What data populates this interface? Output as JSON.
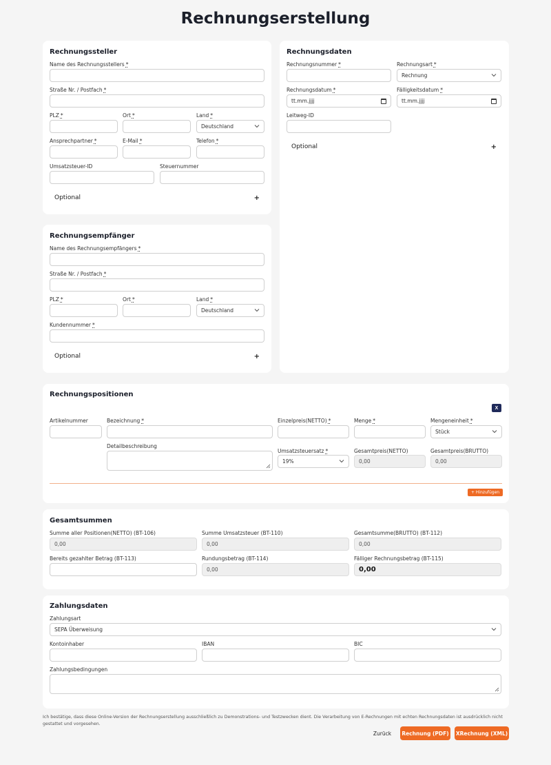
{
  "page": {
    "title": "Rechnungserstellung"
  },
  "req_mark": "*",
  "seller": {
    "title": "Rechnungssteller",
    "name_label": "Name des Rechnungsstellers",
    "street_label": "Straße Nr. / Postfach",
    "zip_label": "PLZ",
    "city_label": "Ort",
    "country_label": "Land",
    "country_value": "Deutschland",
    "contact_label": "Ansprechpartner",
    "email_label": "E-Mail",
    "phone_label": "Telefon",
    "vat_label": "Umsatzsteuer-ID",
    "tax_label": "Steuernummer",
    "optional_label": "Optional",
    "optional_icon": "+"
  },
  "invoice": {
    "title": "Rechnungsdaten",
    "number_label": "Rechnungsnummer",
    "type_label": "Rechnungsart",
    "type_value": "Rechnung",
    "date_label": "Rechnungsdatum",
    "date_value": "tt.mm.jjjj",
    "due_label": "Fälligkeitsdatum",
    "due_value": "tt.mm.jjjj",
    "leitweg_label": "Leitweg-ID",
    "optional_label": "Optional",
    "optional_icon": "+"
  },
  "recipient": {
    "title": "Rechnungsempfänger",
    "name_label": "Name des Rechnungsempfängers",
    "street_label": "Straße Nr. / Postfach",
    "zip_label": "PLZ",
    "city_label": "Ort",
    "country_label": "Land",
    "country_value": "Deutschland",
    "customer_label": "Kundennummer",
    "optional_label": "Optional",
    "optional_icon": "+"
  },
  "positions": {
    "title": "Rechnungspositionen",
    "remove_label": "X",
    "article_label": "Artikelnummer",
    "desc_label": "Bezeichnung",
    "price_label": "Einzelpreis(NETTO)",
    "qty_label": "Menge",
    "unit_label": "Mengeneinheit",
    "unit_value": "Stück",
    "detail_label": "Detailbeschreibung",
    "vat_label": "Umsatzsteuersatz",
    "vat_value": "19%",
    "net_label": "Gesamtpreis(NETTO)",
    "net_value": "0,00",
    "gross_label": "Gesamtpreis(BRUTTO)",
    "gross_value": "0,00",
    "add_label": "+ Hinzufügen"
  },
  "totals": {
    "title": "Gesamtsummen",
    "sum_net_label": "Summe aller Positionen(NETTO) (BT-106)",
    "sum_net_value": "0,00",
    "sum_vat_label": "Summe Umsatzsteuer (BT-110)",
    "sum_vat_value": "0,00",
    "sum_gross_label": "Gesamtsumme(BRUTTO) (BT-112)",
    "sum_gross_value": "0,00",
    "paid_label": "Bereits gezahlter Betrag (BT-113)",
    "rounding_label": "Rundungsbetrag (BT-114)",
    "rounding_value": "0,00",
    "due_label": "Fälliger Rechnungsbetrag (BT-115)",
    "due_value": "0,00"
  },
  "payment": {
    "title": "Zahlungsdaten",
    "method_label": "Zahlungsart",
    "method_value": "SEPA Überweisung",
    "holder_label": "Kontoinhaber",
    "iban_label": "IBAN",
    "bic_label": "BIC",
    "terms_label": "Zahlungsbedingungen"
  },
  "footer": {
    "disclaimer": "Ich bestätige, dass diese Online-Version der Rechnungserstellung ausschließlich zu Demonstrations- und Testzwecken dient. Die Verarbeitung von E-Rechnungen mit echten Rechnungsdaten ist ausdrücklich nicht gestattet und vorgesehen.",
    "back_label": "Zurück",
    "pdf_label": "Rechnung (PDF)",
    "xml_label": "XRechnung (XML)"
  }
}
